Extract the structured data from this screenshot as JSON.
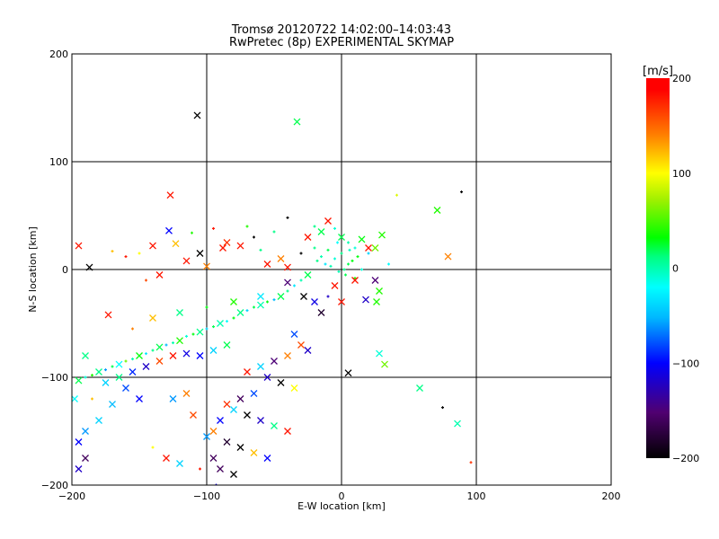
{
  "chart_data": {
    "type": "scatter",
    "title": "Tromsø 20120722 14:02:00–14:03:43",
    "subtitle": "RwPretec (8p) EXPERIMENTAL SKYMAP",
    "xlabel": "E-W location [km]",
    "ylabel": "N-S location [km]",
    "xlim": [
      -200,
      200
    ],
    "ylim": [
      -200,
      200
    ],
    "xticks": [
      "-200",
      "-100",
      "0",
      "100",
      "200"
    ],
    "yticks": [
      "-200",
      "-100",
      "0",
      "100",
      "200"
    ],
    "grid": true,
    "colorbar": {
      "label": "[m/s]",
      "range": [
        -200,
        200
      ],
      "ticks": [
        "200",
        "100",
        "0",
        "-100",
        "-200"
      ],
      "colors": [
        "#000000",
        "#500070",
        "#0000ff",
        "#00b8ff",
        "#00ffff",
        "#00ff80",
        "#00ff00",
        "#a0f000",
        "#ffff00",
        "#ff8000",
        "#ff0000"
      ]
    },
    "points_format": [
      "x_km",
      "y_km",
      "velocity_m_s",
      "marker(1=cross,0=plus)"
    ],
    "points": [
      [
        -107,
        143,
        -200,
        1
      ],
      [
        -33,
        137,
        20,
        1
      ],
      [
        -127,
        69,
        180,
        1
      ],
      [
        89,
        72,
        -200,
        0
      ],
      [
        41,
        69,
        90,
        0
      ],
      [
        71,
        55,
        40,
        1
      ],
      [
        79,
        12,
        140,
        1
      ],
      [
        -195,
        22,
        180,
        1
      ],
      [
        -187,
        2,
        -200,
        1
      ],
      [
        -173,
        -42,
        180,
        1
      ],
      [
        5,
        -96,
        -200,
        1
      ],
      [
        58,
        -110,
        10,
        1
      ],
      [
        75,
        -128,
        -200,
        0
      ],
      [
        86,
        -143,
        0,
        1
      ],
      [
        96,
        -179,
        170,
        0
      ],
      [
        -93,
        -200,
        -110,
        0
      ],
      [
        -128,
        36,
        -100,
        1
      ],
      [
        -123,
        24,
        120,
        1
      ],
      [
        -140,
        22,
        180,
        1
      ],
      [
        -111,
        34,
        40,
        0
      ],
      [
        -105,
        15,
        -200,
        1
      ],
      [
        -115,
        8,
        180,
        1
      ],
      [
        -100,
        3,
        140,
        1
      ],
      [
        -88,
        20,
        180,
        1
      ],
      [
        -85,
        25,
        170,
        1
      ],
      [
        -75,
        22,
        180,
        1
      ],
      [
        -60,
        18,
        10,
        0
      ],
      [
        -55,
        5,
        180,
        1
      ],
      [
        -45,
        10,
        140,
        1
      ],
      [
        -40,
        2,
        180,
        1
      ],
      [
        -30,
        15,
        -200,
        0
      ],
      [
        -25,
        30,
        180,
        1
      ],
      [
        -20,
        40,
        10,
        0
      ],
      [
        -15,
        35,
        20,
        1
      ],
      [
        -10,
        45,
        180,
        1
      ],
      [
        -5,
        38,
        -10,
        0
      ],
      [
        0,
        30,
        20,
        1
      ],
      [
        5,
        25,
        0,
        0
      ],
      [
        10,
        20,
        -10,
        0
      ],
      [
        15,
        28,
        30,
        1
      ],
      [
        20,
        15,
        -40,
        0
      ],
      [
        25,
        20,
        60,
        1
      ],
      [
        30,
        32,
        40,
        1
      ],
      [
        35,
        5,
        -20,
        0
      ],
      [
        25,
        -10,
        -150,
        1
      ],
      [
        28,
        -20,
        40,
        1
      ],
      [
        -20,
        20,
        10,
        0
      ],
      [
        -15,
        12,
        0,
        0
      ],
      [
        -10,
        18,
        20,
        0
      ],
      [
        -5,
        10,
        -10,
        0
      ],
      [
        0,
        15,
        10,
        0
      ],
      [
        5,
        5,
        20,
        0
      ],
      [
        -8,
        3,
        0,
        0
      ],
      [
        -3,
        25,
        -20,
        0
      ],
      [
        2,
        0,
        10,
        0
      ],
      [
        8,
        8,
        30,
        0
      ],
      [
        -12,
        5,
        -30,
        0
      ],
      [
        3,
        -5,
        20,
        0
      ],
      [
        10,
        -8,
        40,
        0
      ],
      [
        15,
        0,
        -10,
        0
      ],
      [
        -18,
        8,
        10,
        0
      ],
      [
        -2,
        -2,
        0,
        0
      ],
      [
        6,
        18,
        -5,
        0
      ],
      [
        12,
        12,
        30,
        0
      ],
      [
        -25,
        -5,
        20,
        1
      ],
      [
        -30,
        -10,
        0,
        0
      ],
      [
        -35,
        -15,
        -30,
        0
      ],
      [
        -40,
        -20,
        10,
        0
      ],
      [
        -45,
        -25,
        20,
        1
      ],
      [
        -50,
        -28,
        -50,
        0
      ],
      [
        -55,
        -30,
        30,
        0
      ],
      [
        -60,
        -33,
        0,
        1
      ],
      [
        -65,
        -35,
        20,
        0
      ],
      [
        -70,
        -38,
        -40,
        0
      ],
      [
        -75,
        -40,
        10,
        1
      ],
      [
        -80,
        -45,
        30,
        0
      ],
      [
        -85,
        -48,
        -20,
        0
      ],
      [
        -90,
        -50,
        0,
        1
      ],
      [
        -95,
        -53,
        20,
        0
      ],
      [
        -100,
        -55,
        -40,
        0
      ],
      [
        -105,
        -58,
        10,
        1
      ],
      [
        -110,
        -60,
        30,
        0
      ],
      [
        -115,
        -62,
        -10,
        0
      ],
      [
        -120,
        -66,
        40,
        1
      ],
      [
        -125,
        -68,
        0,
        0
      ],
      [
        -130,
        -70,
        -50,
        0
      ],
      [
        -135,
        -72,
        20,
        1
      ],
      [
        -140,
        -75,
        10,
        0
      ],
      [
        -145,
        -78,
        -30,
        0
      ],
      [
        -150,
        -80,
        30,
        1
      ],
      [
        -155,
        -83,
        0,
        0
      ],
      [
        -160,
        -85,
        60,
        0
      ],
      [
        -165,
        -88,
        -20,
        1
      ],
      [
        -170,
        -90,
        20,
        0
      ],
      [
        -175,
        -93,
        -60,
        0
      ],
      [
        -180,
        -95,
        10,
        1
      ],
      [
        -185,
        -98,
        40,
        0
      ],
      [
        -190,
        -100,
        -10,
        0
      ],
      [
        -195,
        -103,
        20,
        1
      ],
      [
        -40,
        -12,
        -150,
        1
      ],
      [
        -28,
        -25,
        -200,
        1
      ],
      [
        -20,
        -30,
        -110,
        1
      ],
      [
        -15,
        -40,
        -180,
        1
      ],
      [
        -10,
        -25,
        -120,
        0
      ],
      [
        -5,
        -15,
        180,
        1
      ],
      [
        0,
        -30,
        180,
        1
      ],
      [
        -35,
        -60,
        -80,
        1
      ],
      [
        -30,
        -70,
        160,
        1
      ],
      [
        -25,
        -75,
        -120,
        1
      ],
      [
        -40,
        -80,
        140,
        1
      ],
      [
        -50,
        -85,
        -150,
        1
      ],
      [
        -60,
        -90,
        -40,
        1
      ],
      [
        -70,
        -95,
        180,
        1
      ],
      [
        -55,
        -100,
        -120,
        1
      ],
      [
        -45,
        -105,
        -200,
        1
      ],
      [
        -35,
        -110,
        100,
        1
      ],
      [
        -65,
        -115,
        -80,
        1
      ],
      [
        -75,
        -120,
        -160,
        1
      ],
      [
        -85,
        -125,
        170,
        1
      ],
      [
        -80,
        -130,
        -40,
        1
      ],
      [
        -70,
        -135,
        -200,
        1
      ],
      [
        -60,
        -140,
        -120,
        1
      ],
      [
        -50,
        -145,
        10,
        1
      ],
      [
        -40,
        -150,
        180,
        1
      ],
      [
        -90,
        -140,
        -100,
        1
      ],
      [
        -95,
        -150,
        140,
        1
      ],
      [
        -100,
        -155,
        -60,
        1
      ],
      [
        -85,
        -160,
        -180,
        1
      ],
      [
        -75,
        -165,
        -200,
        1
      ],
      [
        -65,
        -170,
        120,
        1
      ],
      [
        -55,
        -175,
        -100,
        1
      ],
      [
        -95,
        -175,
        -160,
        1
      ],
      [
        -90,
        -185,
        -160,
        1
      ],
      [
        -80,
        -190,
        -200,
        1
      ],
      [
        -105,
        -185,
        180,
        0
      ],
      [
        -120,
        -180,
        -40,
        1
      ],
      [
        -130,
        -175,
        180,
        1
      ],
      [
        -140,
        -165,
        100,
        0
      ],
      [
        -110,
        -135,
        160,
        1
      ],
      [
        -115,
        -115,
        140,
        1
      ],
      [
        -125,
        -120,
        -60,
        1
      ],
      [
        -150,
        -120,
        -100,
        1
      ],
      [
        -160,
        -110,
        -80,
        1
      ],
      [
        -170,
        -125,
        -50,
        1
      ],
      [
        -180,
        -140,
        -40,
        1
      ],
      [
        -190,
        -150,
        -60,
        1
      ],
      [
        -195,
        -160,
        -100,
        1
      ],
      [
        -190,
        -175,
        -160,
        1
      ],
      [
        -195,
        -185,
        -120,
        1
      ],
      [
        -185,
        -120,
        120,
        0
      ],
      [
        -175,
        -105,
        -40,
        1
      ],
      [
        -165,
        -100,
        10,
        1
      ],
      [
        -155,
        -95,
        -90,
        1
      ],
      [
        -145,
        -90,
        -120,
        1
      ],
      [
        -135,
        -85,
        160,
        1
      ],
      [
        -125,
        -80,
        180,
        1
      ],
      [
        -115,
        -78,
        -110,
        1
      ],
      [
        -105,
        -80,
        -100,
        1
      ],
      [
        -95,
        -75,
        -40,
        1
      ],
      [
        -85,
        -70,
        20,
        1
      ],
      [
        -155,
        -55,
        140,
        0
      ],
      [
        -140,
        -45,
        120,
        1
      ],
      [
        -120,
        -40,
        10,
        1
      ],
      [
        -100,
        -35,
        30,
        0
      ],
      [
        -80,
        -30,
        40,
        1
      ],
      [
        -60,
        -25,
        -30,
        1
      ],
      [
        -190,
        -80,
        10,
        1
      ],
      [
        -198,
        -120,
        -20,
        1
      ],
      [
        -160,
        12,
        180,
        0
      ],
      [
        -150,
        15,
        100,
        0
      ],
      [
        -135,
        -5,
        180,
        1
      ],
      [
        -145,
        -10,
        160,
        0
      ],
      [
        -170,
        17,
        120,
        0
      ],
      [
        -95,
        38,
        180,
        0
      ],
      [
        -70,
        40,
        40,
        0
      ],
      [
        -65,
        30,
        -200,
        0
      ],
      [
        -50,
        35,
        10,
        0
      ],
      [
        -40,
        48,
        -200,
        0
      ],
      [
        20,
        20,
        180,
        1
      ],
      [
        26,
        -30,
        40,
        1
      ],
      [
        18,
        -28,
        -120,
        1
      ],
      [
        10,
        -10,
        180,
        1
      ],
      [
        32,
        -88,
        60,
        1
      ],
      [
        28,
        -78,
        -10,
        1
      ]
    ]
  }
}
